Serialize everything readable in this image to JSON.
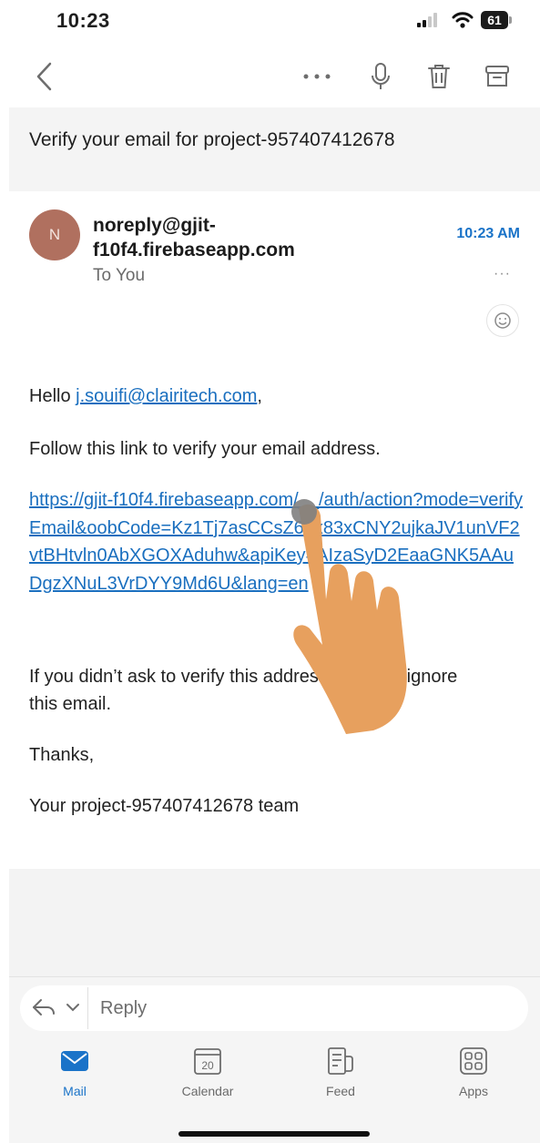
{
  "status_bar": {
    "time": "10:23",
    "battery": "61"
  },
  "toolbar": {
    "back_icon": "chevron-left-icon",
    "more_icon": "ellipsis-icon",
    "mic_icon": "microphone-icon",
    "trash_icon": "trash-icon",
    "archive_icon": "archive-icon"
  },
  "email": {
    "subject": "Verify your email for project-957407412678",
    "avatar_initial": "N",
    "avatar_color": "#b0705f",
    "sender": "noreply@gjit-f10f4.firebaseapp.com",
    "recipient": "To You",
    "time": "10:23 AM",
    "more": "···",
    "body": {
      "greeting_prefix": "Hello ",
      "greeting_email": "j.souifi@clairitech.com",
      "greeting_suffix": ",",
      "follow": "Follow this link to verify your email address.",
      "link": "https://gjit-f10f4.firebaseapp.com/__/auth/action?mode=verifyEmail&oobCode=Kz1Tj7asCCsZ6ex83xCNY2ujkaJV1unVF2vtBHtvln0AbXGOXAduhw&apiKey=AIzaSyD2EaaGNK5AAuDgzXNuL3VrDYY9Md6U&lang=en",
      "ignore": "If you didn’t ask to verify this address, you can ignore this email.",
      "thanks": "Thanks,",
      "team": "Your project-957407412678 team"
    }
  },
  "reply": {
    "placeholder": "Reply"
  },
  "tabs": [
    {
      "label": "Mail",
      "icon": "mail-icon",
      "active": true
    },
    {
      "label": "Calendar",
      "icon": "calendar-icon",
      "badge": "20"
    },
    {
      "label": "Feed",
      "icon": "feed-icon"
    },
    {
      "label": "Apps",
      "icon": "apps-icon"
    }
  ],
  "colors": {
    "accent": "#1a73c8",
    "link": "#1a6fbf",
    "hand": "#e7a05e"
  }
}
